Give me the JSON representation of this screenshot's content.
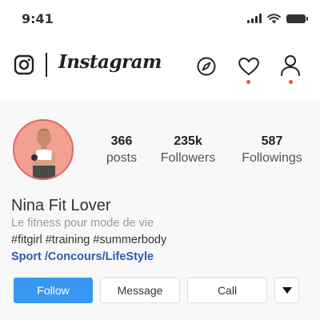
{
  "status_bar": {
    "time": "9:41"
  },
  "header": {
    "app_name": "Instagram",
    "icons": [
      "instagram-logo-icon",
      "compass-icon",
      "heart-icon",
      "user-icon"
    ],
    "notification_color": "#f04b4b"
  },
  "profile": {
    "stats": [
      {
        "value": "366",
        "label": "posts"
      },
      {
        "value": "235k",
        "label": "Followers"
      },
      {
        "value": "587",
        "label": "Followings"
      }
    ],
    "name": "Nina Fit Lover",
    "bio": "Le fitness pour mode de vie",
    "hashtags": "#fitgirl #training #summerbody",
    "link": "Sport /Concours/LifeStyle"
  },
  "actions": {
    "follow": "Follow",
    "message": "Message",
    "call": "Call"
  },
  "colors": {
    "accent": "#3897f0",
    "link": "#2a5db0",
    "avatar_ring": "#e06666"
  }
}
